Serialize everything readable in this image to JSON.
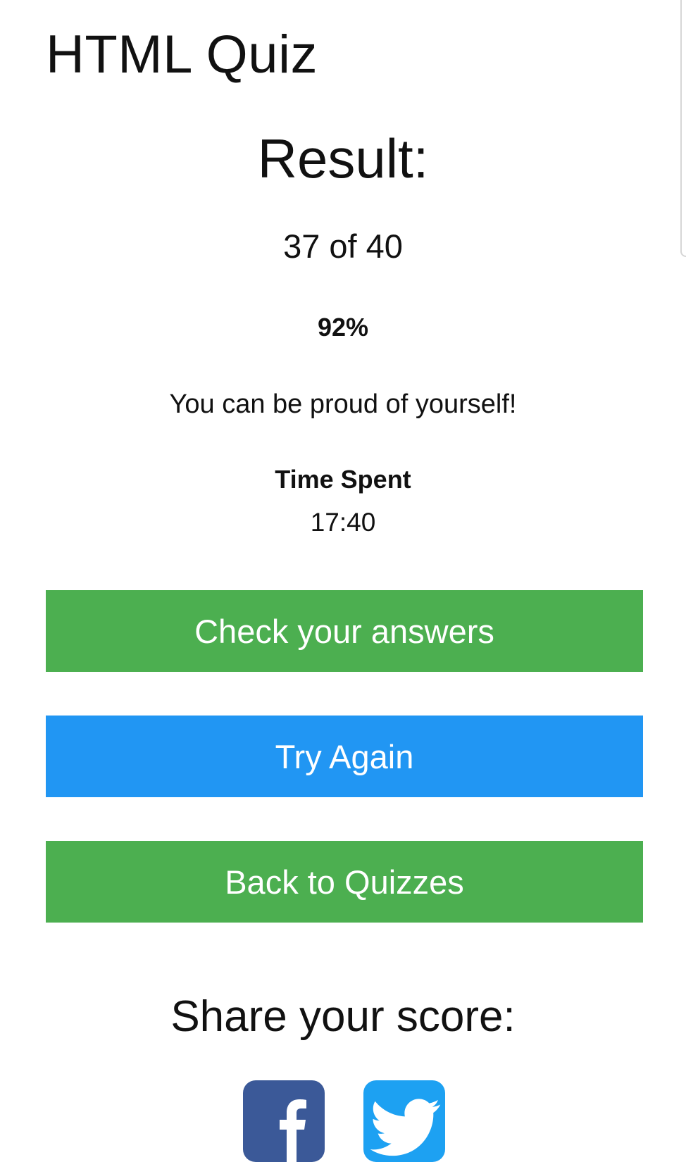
{
  "page": {
    "title": "HTML Quiz"
  },
  "result": {
    "heading": "Result:",
    "score_text": "37 of 40",
    "percent_text": "92%",
    "message": "You can be proud of yourself!",
    "time_label": "Time Spent",
    "time_value": "17:40"
  },
  "actions": {
    "check_answers_label": "Check your answers",
    "try_again_label": "Try Again",
    "back_label": "Back to Quizzes"
  },
  "share": {
    "heading": "Share your score:",
    "icons": [
      "facebook-icon",
      "twitter-icon"
    ]
  },
  "colors": {
    "green": "#4CAF50",
    "blue": "#2196F3",
    "facebook": "#3B5998",
    "twitter": "#1DA1F2"
  }
}
